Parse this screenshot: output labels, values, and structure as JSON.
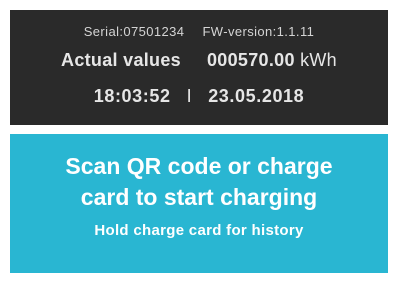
{
  "device": {
    "serial_text": "Serial:07501234",
    "fw_text": "FW-version:1.1.11",
    "actual_label": "Actual values",
    "meter_value": "000570.00",
    "meter_unit": "kWh",
    "time": "18:03:52",
    "separator": "I",
    "date": "23.05.2018"
  },
  "message": {
    "line1": "Scan QR code or charge",
    "line2": "card to start charging",
    "subline": "Hold charge card for history"
  },
  "colors": {
    "status_bg": "#2a2a2a",
    "message_bg": "#29b6d2",
    "text_light": "#e6e6e6"
  }
}
